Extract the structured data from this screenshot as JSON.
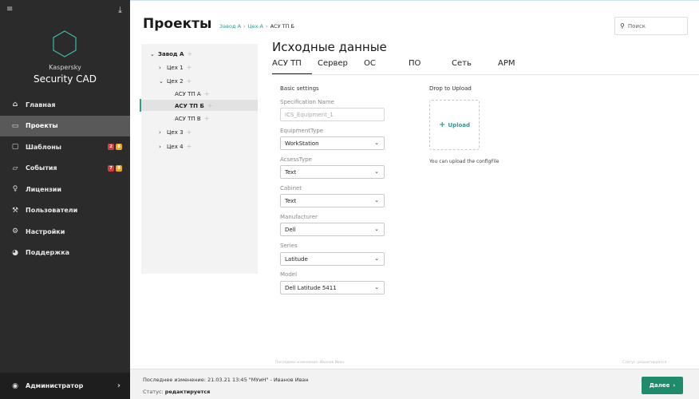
{
  "sidebar": {
    "brand_line1": "Kaspersky",
    "brand_line2": "Security CAD",
    "nav": [
      {
        "label": "Главная",
        "icon": "home-icon"
      },
      {
        "label": "Проекты",
        "icon": "folder-icon",
        "active": true
      },
      {
        "label": "Шаблоны",
        "icon": "template-icon",
        "badges": [
          "2",
          "8"
        ]
      },
      {
        "label": "События",
        "icon": "chat-icon",
        "badges": [
          "7",
          "8"
        ]
      },
      {
        "label": "Лицензии",
        "icon": "key-icon"
      },
      {
        "label": "Пользователи",
        "icon": "wrench-icon"
      },
      {
        "label": "Настройки",
        "icon": "gear-icon"
      },
      {
        "label": "Поддержка",
        "icon": "support-icon"
      }
    ],
    "user": "Администратор"
  },
  "header": {
    "title": "Проекты",
    "breadcrumb": [
      "Завод А",
      "Цех А",
      "АСУ ТП Б"
    ],
    "search_placeholder": "Поиск"
  },
  "tree": [
    {
      "label": "Завод А",
      "caret": "⌄",
      "bold": true
    },
    {
      "label": "Цех 1",
      "caret": "›"
    },
    {
      "label": "Цех 2",
      "caret": "⌄"
    },
    {
      "label": "АСУ ТП А",
      "caret": ""
    },
    {
      "label": "АСУ ТП Б",
      "caret": "",
      "selected": true,
      "bold": true
    },
    {
      "label": "АСУ ТП В",
      "caret": ""
    },
    {
      "label": "Цех 3",
      "caret": "›"
    },
    {
      "label": "Цех 4",
      "caret": "›"
    }
  ],
  "main": {
    "section_title": "Исходные данные",
    "tabs": [
      "АСУ ТП",
      "Сервер",
      "ОС",
      "ПО",
      "Сеть",
      "АРМ"
    ],
    "basic_settings": "Basic settings",
    "fields": {
      "spec_label": "Specification Name",
      "spec_placeholder": "ICS_Equipment_1",
      "equipment_label": "EquipmentType",
      "equipment_value": "WorkStation",
      "access_label": "AcsessType",
      "access_value": "Text",
      "cabinet_label": "Cabinet",
      "cabinet_value": "Text",
      "manufacturer_label": "Manufacturer",
      "manufacturer_value": "Dell",
      "series_label": "Series",
      "series_value": "Latitude",
      "model_label": "Model",
      "model_value": "Dell Latitude 5411"
    },
    "drop_title": "Drop to Upload",
    "upload_label": "Upload",
    "upload_hint": "You can upload the  configFile",
    "faint_left": "Последнее изменение: Иванов Иван",
    "faint_right": "Статус: редактируется"
  },
  "footer": {
    "last_change": "Последнее изменение: 21.03.21 13:45 \"МУиН\" - Иванов Иван",
    "status_label": "Статус:",
    "status_value": "редактируется",
    "next_label": "Далее"
  }
}
